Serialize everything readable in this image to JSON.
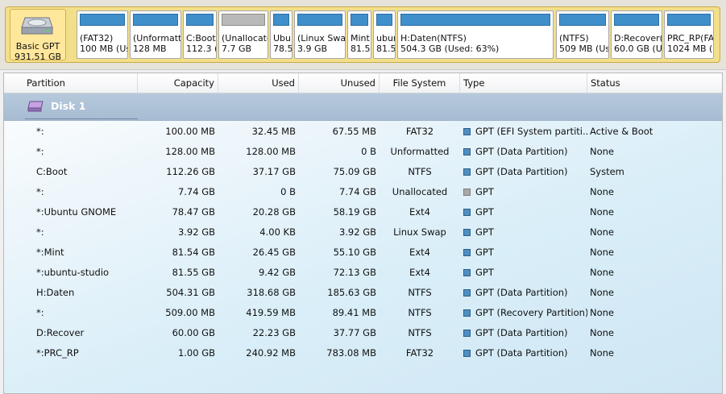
{
  "disk_map": {
    "disk_info": {
      "line1": "Basic GPT",
      "line2": "931.51 GB"
    },
    "blocks": [
      {
        "line1": "(FAT32)",
        "line2": "100 MB (Used",
        "bar": "blue"
      },
      {
        "line1": "(Unformatte",
        "line2": "128 MB",
        "bar": "blue"
      },
      {
        "line1": "C:Boot",
        "line2": "112.3 (",
        "bar": "blue"
      },
      {
        "line1": "(Unallocate",
        "line2": "7.7 GB",
        "bar": "gray"
      },
      {
        "line1": "Ubu",
        "line2": "78.5",
        "bar": "blue"
      },
      {
        "line1": "(Linux Swap",
        "line2": "3.9 GB",
        "bar": "blue"
      },
      {
        "line1": "Mint",
        "line2": "81.5",
        "bar": "blue"
      },
      {
        "line1": "ubun",
        "line2": "81.5",
        "bar": "blue"
      },
      {
        "line1": "H:Daten(NTFS)",
        "line2": "504.3 GB (Used: 63%)",
        "bar": "blue"
      },
      {
        "line1": "(NTFS)",
        "line2": "509 MB (Use",
        "bar": "blue"
      },
      {
        "line1": "D:Recover(",
        "line2": "60.0 GB (Us",
        "bar": "blue"
      },
      {
        "line1": "PRC_RP(FA",
        "line2": "1024 MB (U",
        "bar": "blue"
      }
    ]
  },
  "table": {
    "headers": [
      "Partition",
      "Capacity",
      "Used",
      "Unused",
      "File System",
      "Type",
      "Status"
    ],
    "disk_label": "Disk 1",
    "rows": [
      {
        "partition": "*:",
        "capacity": "100.00 MB",
        "used": "32.45 MB",
        "unused": "67.55 MB",
        "fs": "FAT32",
        "type": "GPT (EFI System partiti...",
        "status": "Active & Boot",
        "color": "blue"
      },
      {
        "partition": "*:",
        "capacity": "128.00 MB",
        "used": "128.00 MB",
        "unused": "0 B",
        "fs": "Unformatted",
        "type": "GPT (Data Partition)",
        "status": "None",
        "color": "blue"
      },
      {
        "partition": "C:Boot",
        "capacity": "112.26 GB",
        "used": "37.17 GB",
        "unused": "75.09 GB",
        "fs": "NTFS",
        "type": "GPT (Data Partition)",
        "status": "System",
        "color": "blue"
      },
      {
        "partition": "*:",
        "capacity": "7.74 GB",
        "used": "0 B",
        "unused": "7.74 GB",
        "fs": "Unallocated",
        "type": "GPT",
        "status": "None",
        "color": "gray"
      },
      {
        "partition": "*:Ubuntu GNOME",
        "capacity": "78.47 GB",
        "used": "20.28 GB",
        "unused": "58.19 GB",
        "fs": "Ext4",
        "type": "GPT",
        "status": "None",
        "color": "blue"
      },
      {
        "partition": "*:",
        "capacity": "3.92 GB",
        "used": "4.00 KB",
        "unused": "3.92 GB",
        "fs": "Linux Swap",
        "type": "GPT",
        "status": "None",
        "color": "blue"
      },
      {
        "partition": "*:Mint",
        "capacity": "81.54 GB",
        "used": "26.45 GB",
        "unused": "55.10 GB",
        "fs": "Ext4",
        "type": "GPT",
        "status": "None",
        "color": "blue"
      },
      {
        "partition": "*:ubuntu-studio",
        "capacity": "81.55 GB",
        "used": "9.42 GB",
        "unused": "72.13 GB",
        "fs": "Ext4",
        "type": "GPT",
        "status": "None",
        "color": "blue"
      },
      {
        "partition": "H:Daten",
        "capacity": "504.31 GB",
        "used": "318.68 GB",
        "unused": "185.63 GB",
        "fs": "NTFS",
        "type": "GPT (Data Partition)",
        "status": "None",
        "color": "blue"
      },
      {
        "partition": "*:",
        "capacity": "509.00 MB",
        "used": "419.59 MB",
        "unused": "89.41 MB",
        "fs": "NTFS",
        "type": "GPT (Recovery Partition)",
        "status": "None",
        "color": "blue"
      },
      {
        "partition": "D:Recover",
        "capacity": "60.00 GB",
        "used": "22.23 GB",
        "unused": "37.77 GB",
        "fs": "NTFS",
        "type": "GPT (Data Partition)",
        "status": "None",
        "color": "blue"
      },
      {
        "partition": "*:PRC_RP",
        "capacity": "1.00 GB",
        "used": "240.92 MB",
        "unused": "783.08 MB",
        "fs": "FAT32",
        "type": "GPT (Data Partition)",
        "status": "None",
        "color": "blue"
      }
    ]
  }
}
